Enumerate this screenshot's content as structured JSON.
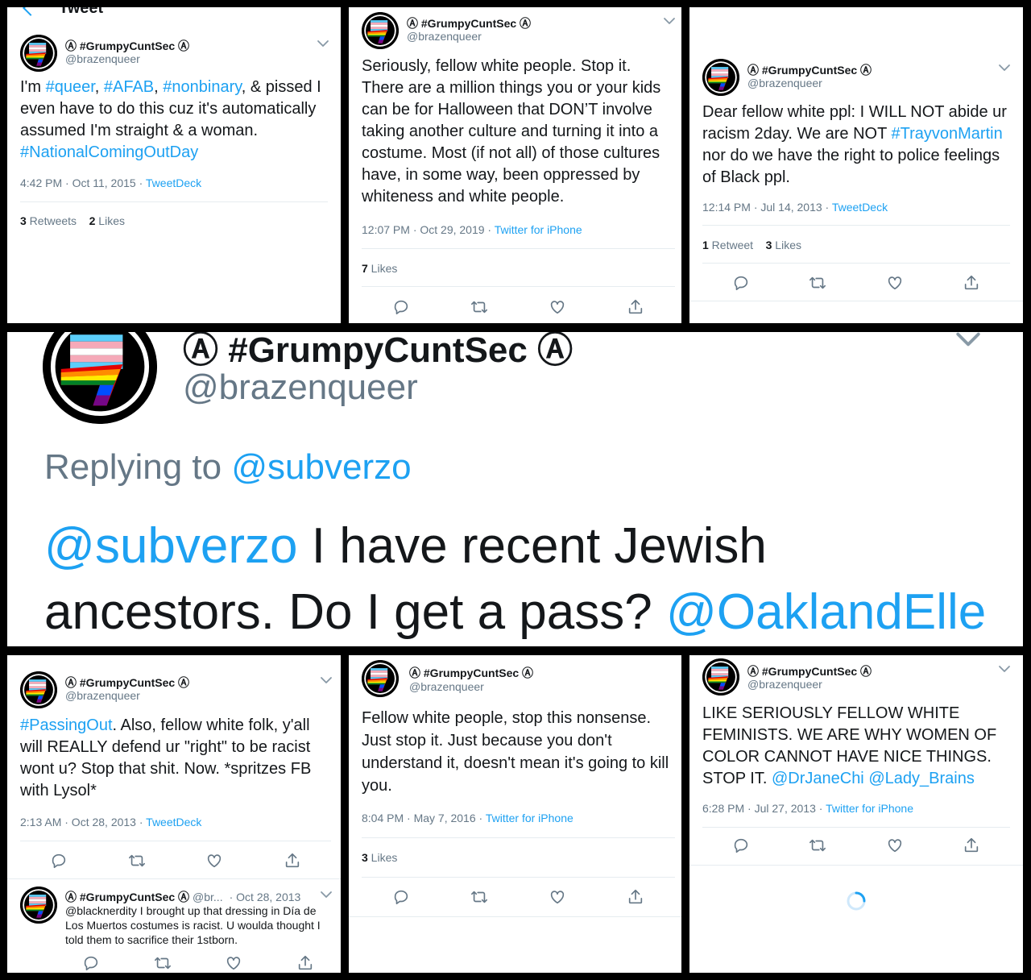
{
  "author": {
    "name": "Ⓐ #GrumpyCuntSec Ⓐ",
    "handle": "@brazenqueer"
  },
  "p1": {
    "topbar_title": "Tweet",
    "body": [
      {
        "t": "I'm "
      },
      {
        "t": "#queer",
        "link": true
      },
      {
        "t": ", "
      },
      {
        "t": "#AFAB",
        "link": true
      },
      {
        "t": ", "
      },
      {
        "t": "#nonbinary",
        "link": true
      },
      {
        "t": ", & pissed I even have to do this cuz it's automatically assumed I'm straight & a woman. "
      },
      {
        "t": "#NationalComingOutDay",
        "link": true
      }
    ],
    "time": "4:42 PM · Oct 11, 2015 · ",
    "source": "TweetDeck",
    "stat1_num": "3",
    "stat1_label": " Retweets",
    "stat2_num": "2",
    "stat2_label": " Likes"
  },
  "p2": {
    "body": [
      {
        "t": "Seriously, fellow white people. Stop it. There are a million things you or your kids can be for Halloween that DON’T involve taking another culture and turning it into a costume. Most (if not all) of those cultures have, in some way, been oppressed by whiteness and white people."
      }
    ],
    "time": "12:07 PM · Oct 29, 2019 · ",
    "source": "Twitter for iPhone",
    "stat1_num": "7",
    "stat1_label": " Likes"
  },
  "p3": {
    "body": [
      {
        "t": "Dear fellow white ppl: I WILL NOT abide ur racism 2day. We are NOT "
      },
      {
        "t": "#TrayvonMartin",
        "link": true
      },
      {
        "t": " nor do we have the right to police feelings of Black ppl."
      }
    ],
    "time": "12:14 PM · Jul 14, 2013 · ",
    "source": "TweetDeck",
    "stat1_num": "1",
    "stat1_label": " Retweet",
    "stat2_num": "3",
    "stat2_label": " Likes"
  },
  "p4": {
    "replying_label": "Replying to ",
    "replying_handle": "@subverzo",
    "body": [
      {
        "t": "@subverzo",
        "link": true
      },
      {
        "t": " I have recent Jewish ancestors. Do I get a pass? "
      },
      {
        "t": "@OaklandElle",
        "link": true
      }
    ]
  },
  "p5": {
    "body": [
      {
        "t": "#PassingOut",
        "link": true
      },
      {
        "t": ". Also, fellow white folk, y'all will REALLY defend ur \"right\" to be racist wont u? Stop that shit. Now. *spritzes FB with Lysol*"
      }
    ],
    "time": "2:13 AM · Oct 28, 2013 · ",
    "source": "TweetDeck",
    "reply": {
      "handle_short": "@br...",
      "date": "· Oct 28, 2013",
      "body": "@blacknerdity I brought up that dressing in Día de Los Muertos costumes is racist. U woulda thought I told them to sacrifice their 1stborn."
    }
  },
  "p6": {
    "body": [
      {
        "t": "Fellow white people, stop this nonsense. Just stop it. Just because you don't understand it, doesn't mean it's going to kill you."
      }
    ],
    "time": "8:04 PM · May 7, 2016 · ",
    "source": "Twitter for iPhone",
    "stat1_num": "3",
    "stat1_label": " Likes"
  },
  "p7": {
    "body": [
      {
        "t": "LIKE SERIOUSLY FELLOW WHITE FEMINISTS. WE ARE WHY WOMEN OF COLOR CANNOT HAVE NICE THINGS. STOP IT. "
      },
      {
        "t": "@DrJaneChi",
        "link": true
      },
      {
        "t": " "
      },
      {
        "t": "@Lady_Brains",
        "link": true
      }
    ],
    "time": "6:28 PM · Jul 27, 2013 · ",
    "source": "Twitter for iPhone"
  },
  "colors": {
    "link": "#1da1f2",
    "muted": "#657786",
    "text": "#14171a",
    "divider": "#e6ecf0",
    "frame": "#000000"
  },
  "icons": [
    "antifa-rainbow-flag-avatar",
    "chevron-down-icon",
    "reply-icon",
    "retweet-icon",
    "like-icon",
    "share-icon",
    "back-arrow-icon",
    "loading-spinner-icon"
  ]
}
